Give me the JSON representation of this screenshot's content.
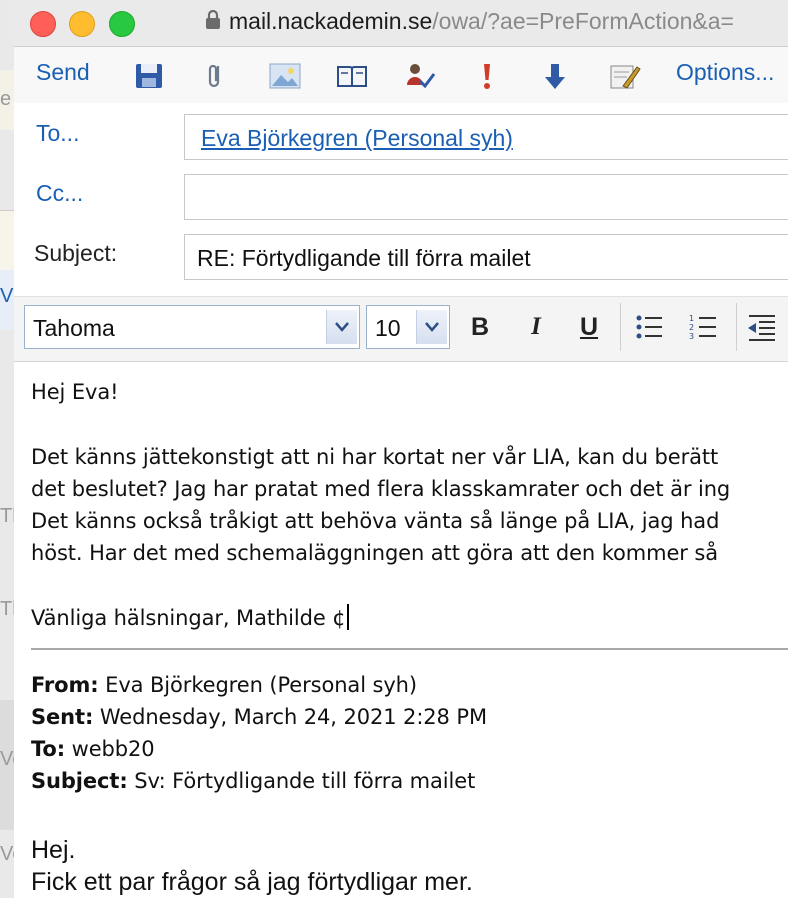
{
  "browser": {
    "url_host": "mail.nackademin.se",
    "url_path": "/owa/?ae=PreFormAction&a="
  },
  "toolbar": {
    "send_label": "Send",
    "options_label": "Options...",
    "icons": [
      "save-icon",
      "attach-icon",
      "insert-image-icon",
      "address-book-icon",
      "check-names-icon",
      "high-importance-icon",
      "low-importance-icon",
      "signature-icon"
    ]
  },
  "header": {
    "to_label": "To...",
    "to_value": "Eva Björkegren (Personal syh)",
    "cc_label": "Cc...",
    "cc_value": "",
    "subject_label": "Subject:",
    "subject_value": "RE: Förtydligande till förra mailet"
  },
  "format": {
    "font": "Tahoma",
    "size": "10",
    "bold_label": "B",
    "italic_label": "I",
    "underline_label": "U"
  },
  "body": {
    "greeting": "Hej Eva!",
    "para_lines": [
      "Det känns jättekonstigt att ni har kortat ner vår LIA, kan du berätt",
      "det beslutet? Jag har pratat med flera klasskamrater och det är ing",
      "Det känns också tråkigt att behöva vänta så länge på LIA, jag had",
      "höst. Har det med schemaläggningen att göra att den kommer så "
    ],
    "signature": "Vänliga hälsningar, Mathilde ¢"
  },
  "quoted": {
    "from_label": "From:",
    "from_value": "Eva Björkegren (Personal syh)",
    "sent_label": "Sent:",
    "sent_value": "Wednesday, March 24, 2021 2:28 PM",
    "to_label": "To:",
    "to_value": "webb20",
    "subject_label": "Subject:",
    "subject_value": "Sv: Förtydligande till förra mailet",
    "line1": "Hej.",
    "line2": "Fick ett par frågor så jag förtydligar mer."
  },
  "colors": {
    "link": "#1a5fb4",
    "close": "#fe5f57",
    "minimize": "#febc2e",
    "maximize": "#28c840"
  }
}
